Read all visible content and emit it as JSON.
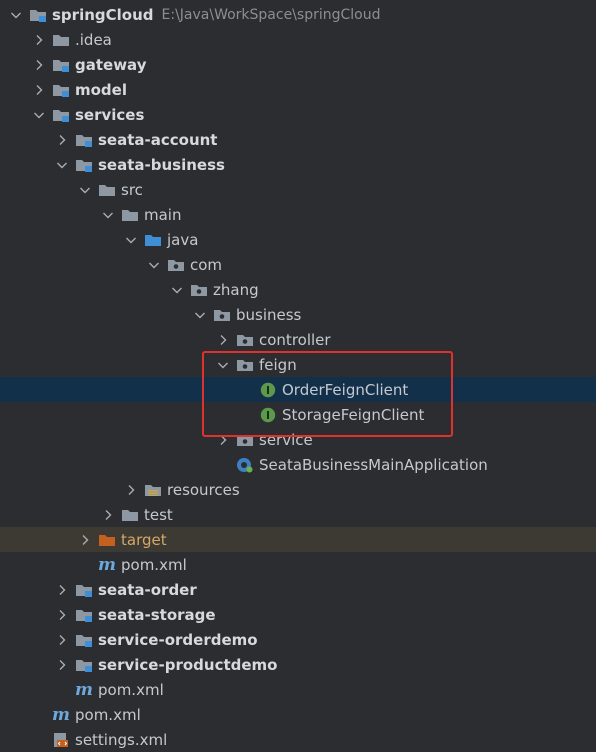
{
  "tree": [
    {
      "name": "springCloud",
      "path": "E:\\Java\\WorkSpace\\springCloud",
      "depth": 0,
      "expanded": true,
      "icon": "module-folder",
      "bold": true
    },
    {
      "name": ".idea",
      "depth": 1,
      "expanded": false,
      "icon": "folder",
      "bold": false
    },
    {
      "name": "gateway",
      "depth": 1,
      "expanded": false,
      "icon": "module-folder",
      "bold": true
    },
    {
      "name": "model",
      "depth": 1,
      "expanded": false,
      "icon": "module-folder",
      "bold": true
    },
    {
      "name": "services",
      "depth": 1,
      "expanded": true,
      "icon": "module-folder",
      "bold": true
    },
    {
      "name": "seata-account",
      "depth": 2,
      "expanded": false,
      "icon": "module-folder",
      "bold": true
    },
    {
      "name": "seata-business",
      "depth": 2,
      "expanded": true,
      "icon": "module-folder",
      "bold": true
    },
    {
      "name": "src",
      "depth": 3,
      "expanded": true,
      "icon": "folder",
      "bold": false
    },
    {
      "name": "main",
      "depth": 4,
      "expanded": true,
      "icon": "folder",
      "bold": false
    },
    {
      "name": "java",
      "depth": 5,
      "expanded": true,
      "icon": "source-folder",
      "bold": false
    },
    {
      "name": "com",
      "depth": 6,
      "expanded": true,
      "icon": "package",
      "bold": false
    },
    {
      "name": "zhang",
      "depth": 7,
      "expanded": true,
      "icon": "package",
      "bold": false
    },
    {
      "name": "business",
      "depth": 8,
      "expanded": true,
      "icon": "package",
      "bold": false
    },
    {
      "name": "controller",
      "depth": 9,
      "expanded": false,
      "icon": "package",
      "bold": false
    },
    {
      "name": "feign",
      "depth": 9,
      "expanded": true,
      "icon": "package",
      "bold": false
    },
    {
      "name": "OrderFeignClient",
      "depth": 10,
      "icon": "interface",
      "bold": false,
      "selected": true
    },
    {
      "name": "StorageFeignClient",
      "depth": 10,
      "icon": "interface",
      "bold": false
    },
    {
      "name": "service",
      "depth": 9,
      "expanded": false,
      "icon": "package",
      "bold": false
    },
    {
      "name": "SeataBusinessMainApplication",
      "depth": 9,
      "icon": "spring-boot-class",
      "bold": false
    },
    {
      "name": "resources",
      "depth": 5,
      "expanded": false,
      "icon": "resources-folder",
      "bold": false
    },
    {
      "name": "test",
      "depth": 4,
      "expanded": false,
      "icon": "folder",
      "bold": false
    },
    {
      "name": "target",
      "depth": 3,
      "expanded": false,
      "icon": "excluded-folder",
      "bold": false,
      "excluded": true
    },
    {
      "name": "pom.xml",
      "depth": 3,
      "icon": "maven-file",
      "bold": false
    },
    {
      "name": "seata-order",
      "depth": 2,
      "expanded": false,
      "icon": "module-folder",
      "bold": true
    },
    {
      "name": "seata-storage",
      "depth": 2,
      "expanded": false,
      "icon": "module-folder",
      "bold": true
    },
    {
      "name": "service-orderdemo",
      "depth": 2,
      "expanded": false,
      "icon": "module-folder",
      "bold": true
    },
    {
      "name": "service-productdemo",
      "depth": 2,
      "expanded": false,
      "icon": "module-folder",
      "bold": true
    },
    {
      "name": "pom.xml",
      "depth": 2,
      "icon": "maven-file",
      "bold": false
    },
    {
      "name": "pom.xml",
      "depth": 1,
      "icon": "maven-file",
      "bold": false
    },
    {
      "name": "settings.xml",
      "depth": 1,
      "icon": "xml-file",
      "bold": false
    }
  ],
  "colors": {
    "background": "#2b2d30",
    "selected_row": "#13304a",
    "excluded_row": "#3d3a33",
    "highlight_border": "#e0312c",
    "folder": "#8e98a3",
    "module_marker": "#3f8fd6",
    "interface_icon": "#5b9a4a",
    "excluded_folder": "#c5611f"
  }
}
